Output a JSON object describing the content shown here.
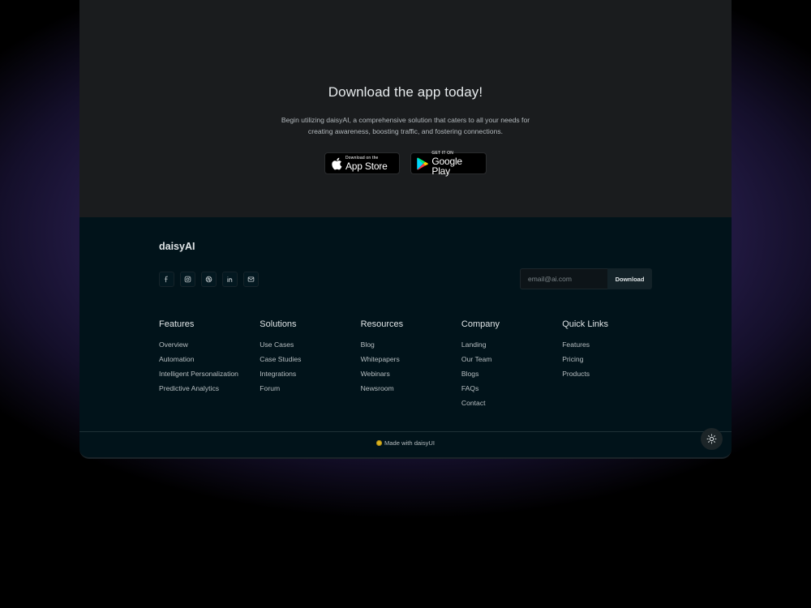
{
  "cta": {
    "title": "Download the app today!",
    "description": "Begin utilizing daisyAI, a comprehensive solution that caters to all your needs for creating awareness, boosting traffic, and fostering connections.",
    "app_store": {
      "small": "Download on the",
      "big": "App Store",
      "icon": "apple-icon"
    },
    "google_play": {
      "small": "GET IT ON",
      "big": "Google Play",
      "icon": "google-play-icon"
    }
  },
  "footer": {
    "brand": "daisyAI",
    "socials": [
      {
        "name": "facebook",
        "icon": "facebook-icon"
      },
      {
        "name": "instagram",
        "icon": "instagram-icon"
      },
      {
        "name": "dribbble",
        "icon": "dribbble-icon"
      },
      {
        "name": "linkedin",
        "icon": "linkedin-icon"
      },
      {
        "name": "email",
        "icon": "mail-icon"
      }
    ],
    "subscribe": {
      "placeholder": "email@ai.com",
      "value": "",
      "button_label": "Download"
    },
    "columns": [
      {
        "title": "Features",
        "links": [
          "Overview",
          "Automation",
          "Intelligent Personalization",
          "Predictive Analytics"
        ]
      },
      {
        "title": "Solutions",
        "links": [
          "Use Cases",
          "Case Studies",
          "Integrations",
          "Forum"
        ]
      },
      {
        "title": "Resources",
        "links": [
          "Blog",
          "Whitepapers",
          "Webinars",
          "Newsroom"
        ]
      },
      {
        "title": "Company",
        "links": [
          "Landing",
          "Our Team",
          "Blogs",
          "FAQs",
          "Contact"
        ]
      },
      {
        "title": "Quick Links",
        "links": [
          "Features",
          "Pricing",
          "Products"
        ]
      }
    ],
    "made_with": "Made with daisyUI",
    "theme_toggle_icon": "sun-icon"
  },
  "colors": {
    "cta_bg": "#1a1c1e",
    "footer_bg": "#01131a",
    "glow": "#3a2a6e",
    "accent_yellow": "#d9b21e"
  }
}
